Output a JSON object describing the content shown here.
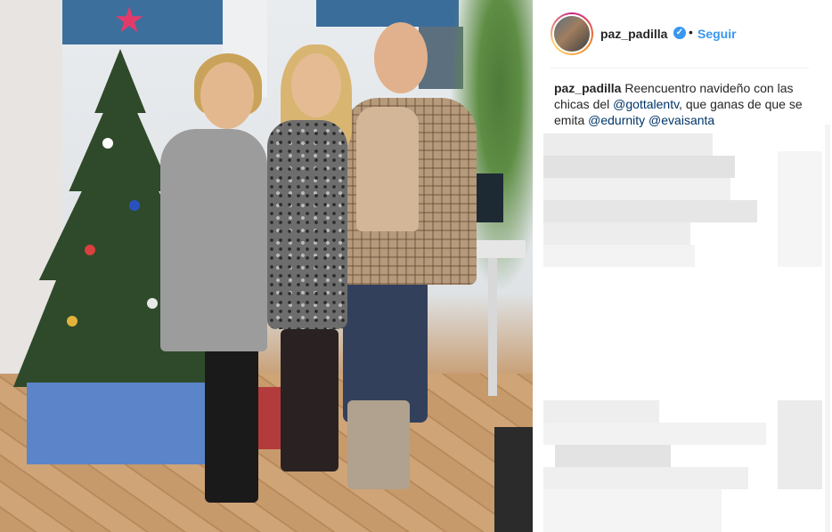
{
  "post": {
    "username": "paz_padilla",
    "verified_icon": "verified-badge-icon",
    "separator": "•",
    "follow_label": "Seguir"
  },
  "caption": {
    "username": "paz_padilla",
    "text_1": " Reencuentro navideño con las chicas del ",
    "mention_1": "@gottalentv",
    "text_2": ", que ganas de que se emita ",
    "mention_2": "@edurnity",
    "text_3": " ",
    "mention_3": "@evaisanta"
  },
  "colors": {
    "link_blue": "#3897f0",
    "mention_blue": "#003569",
    "text": "#262626"
  }
}
